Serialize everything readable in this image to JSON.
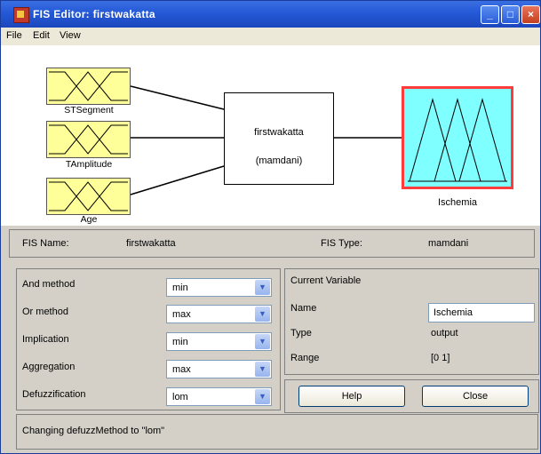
{
  "window": {
    "title": "FIS Editor: firstwakatta"
  },
  "menu": [
    "File",
    "Edit",
    "View"
  ],
  "diagram": {
    "inputs": [
      "STSegment",
      "TAmplitude",
      "Age"
    ],
    "system_name": "firstwakatta",
    "system_type": "(mamdani)",
    "output": "Ischemia"
  },
  "info": {
    "fis_name_label": "FIS Name:",
    "fis_name_value": "firstwakatta",
    "fis_type_label": "FIS Type:",
    "fis_type_value": "mamdani"
  },
  "methods": [
    {
      "label": "And method",
      "value": "min"
    },
    {
      "label": "Or method",
      "value": "max"
    },
    {
      "label": "Implication",
      "value": "min"
    },
    {
      "label": "Aggregation",
      "value": "max"
    },
    {
      "label": "Defuzzification",
      "value": "lom"
    }
  ],
  "current_variable": {
    "title": "Current Variable",
    "name_label": "Name",
    "name_value": "Ischemia",
    "type_label": "Type",
    "type_value": "output",
    "range_label": "Range",
    "range_value": "[0 1]"
  },
  "buttons": {
    "help": "Help",
    "close": "Close"
  },
  "status": "Changing defuzzMethod to \"lom\"",
  "colors": {
    "input_mf": "#ffff99",
    "output_mf": "#7fffff",
    "output_border": "#ff3b3b",
    "titlebar": "#2458d6"
  }
}
